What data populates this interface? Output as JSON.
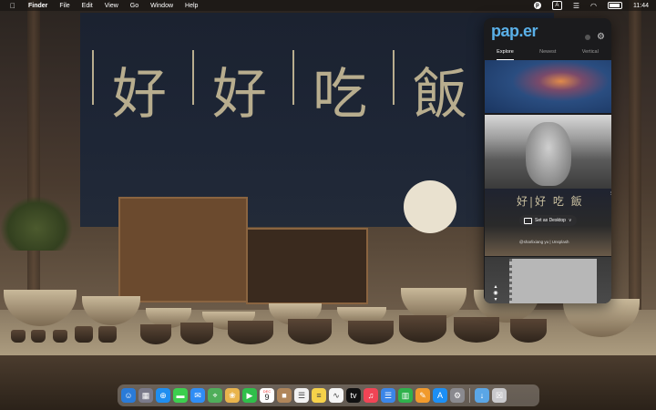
{
  "menubar": {
    "apple_glyph": "",
    "app_name": "Finder",
    "menus": [
      "File",
      "Edit",
      "View",
      "Go",
      "Window",
      "Help"
    ],
    "paper_icon_glyph": "p",
    "input_source": "A",
    "clock": "11:44"
  },
  "wallpaper": {
    "banner_chars": [
      "好",
      "好",
      "吃",
      "飯"
    ]
  },
  "popover": {
    "logo": "pap.er",
    "tabs": [
      "Explore",
      "Newest",
      "Vertical"
    ],
    "active_tab": "Explore",
    "thumb3_text": "好|好 吃 飯",
    "thumb_tag": "Sc",
    "set_desktop_label": "Set as Desktop",
    "set_desktop_chevron": "∨",
    "credit": "@sharlixiang yu | Unsplash",
    "pager_glyphs": "▴\n◉\n▾"
  },
  "dock": {
    "calendar_month": "DEC",
    "calendar_day": "9",
    "apps": [
      {
        "name": "finder",
        "color": "#2a7bd8",
        "glyph": "☺"
      },
      {
        "name": "launchpad",
        "color": "#7a7a8a",
        "glyph": "▦"
      },
      {
        "name": "safari",
        "color": "#1f8ef0",
        "glyph": "⊕"
      },
      {
        "name": "messages",
        "color": "#3ccf4e",
        "glyph": "▬"
      },
      {
        "name": "mail",
        "color": "#2f8df5",
        "glyph": "✉"
      },
      {
        "name": "maps",
        "color": "#4fae5a",
        "glyph": "⌖"
      },
      {
        "name": "photos",
        "color": "#e9b44c",
        "glyph": "❀"
      },
      {
        "name": "facetime",
        "color": "#2fbf4a",
        "glyph": "▶"
      },
      {
        "name": "calendar",
        "color": "#ffffff",
        "glyph": ""
      },
      {
        "name": "contacts",
        "color": "#b0865a",
        "glyph": "■"
      },
      {
        "name": "reminders",
        "color": "#f2f2f2",
        "glyph": "☰"
      },
      {
        "name": "notes",
        "color": "#f6d24a",
        "glyph": "≡"
      },
      {
        "name": "freeform",
        "color": "#f5f5f5",
        "glyph": "∿"
      },
      {
        "name": "tv",
        "color": "#111111",
        "glyph": "tv"
      },
      {
        "name": "music",
        "color": "#f04455",
        "glyph": "♫"
      },
      {
        "name": "keynote",
        "color": "#3b86e8",
        "glyph": "☰"
      },
      {
        "name": "numbers",
        "color": "#2fb24c",
        "glyph": "▥"
      },
      {
        "name": "pages",
        "color": "#f19a2c",
        "glyph": "✎"
      },
      {
        "name": "app-store",
        "color": "#1c8ff5",
        "glyph": "A"
      },
      {
        "name": "system-settings",
        "color": "#8a8a8f",
        "glyph": "⚙"
      }
    ],
    "trailing": [
      {
        "name": "downloads-folder",
        "color": "#5aa6e6",
        "glyph": "↓"
      },
      {
        "name": "trash",
        "color": "#c9c9cc",
        "glyph": "☒"
      }
    ]
  }
}
